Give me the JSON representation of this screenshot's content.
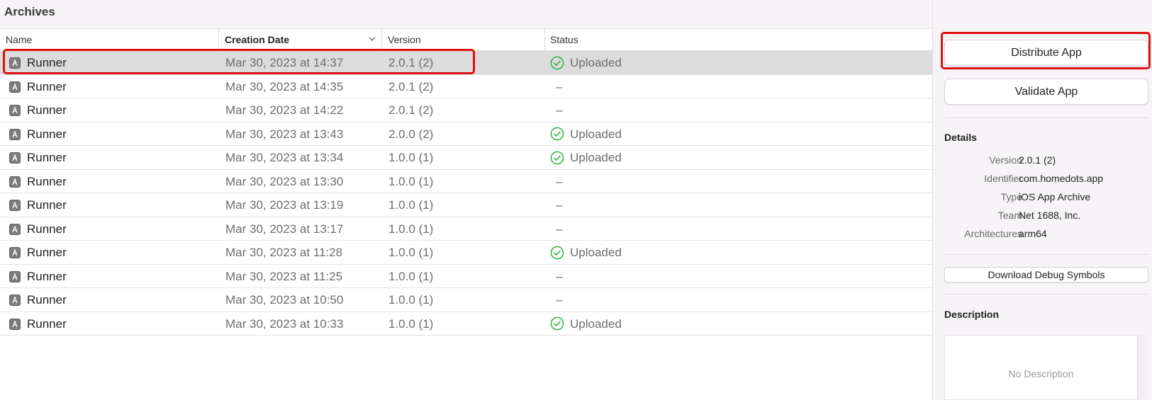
{
  "window": {
    "title": "Archives"
  },
  "columns": {
    "name": "Name",
    "creation_date": "Creation Date",
    "version": "Version",
    "status": "Status"
  },
  "archives": [
    {
      "name": "Runner",
      "date": "Mar 30, 2023 at 14:37",
      "version": "2.0.1 (2)",
      "status": "Uploaded",
      "uploaded": true,
      "selected": true
    },
    {
      "name": "Runner",
      "date": "Mar 30, 2023 at 14:35",
      "version": "2.0.1 (2)",
      "status": "–",
      "uploaded": false,
      "selected": false
    },
    {
      "name": "Runner",
      "date": "Mar 30, 2023 at 14:22",
      "version": "2.0.1 (2)",
      "status": "–",
      "uploaded": false,
      "selected": false
    },
    {
      "name": "Runner",
      "date": "Mar 30, 2023 at 13:43",
      "version": "2.0.0 (2)",
      "status": "Uploaded",
      "uploaded": true,
      "selected": false
    },
    {
      "name": "Runner",
      "date": "Mar 30, 2023 at 13:34",
      "version": "1.0.0 (1)",
      "status": "Uploaded",
      "uploaded": true,
      "selected": false
    },
    {
      "name": "Runner",
      "date": "Mar 30, 2023 at 13:30",
      "version": "1.0.0 (1)",
      "status": "–",
      "uploaded": false,
      "selected": false
    },
    {
      "name": "Runner",
      "date": "Mar 30, 2023 at 13:19",
      "version": "1.0.0 (1)",
      "status": "–",
      "uploaded": false,
      "selected": false
    },
    {
      "name": "Runner",
      "date": "Mar 30, 2023 at 13:17",
      "version": "1.0.0 (1)",
      "status": "–",
      "uploaded": false,
      "selected": false
    },
    {
      "name": "Runner",
      "date": "Mar 30, 2023 at 11:28",
      "version": "1.0.0 (1)",
      "status": "Uploaded",
      "uploaded": true,
      "selected": false
    },
    {
      "name": "Runner",
      "date": "Mar 30, 2023 at 11:25",
      "version": "1.0.0 (1)",
      "status": "–",
      "uploaded": false,
      "selected": false
    },
    {
      "name": "Runner",
      "date": "Mar 30, 2023 at 10:50",
      "version": "1.0.0 (1)",
      "status": "–",
      "uploaded": false,
      "selected": false
    },
    {
      "name": "Runner",
      "date": "Mar 30, 2023 at 10:33",
      "version": "1.0.0 (1)",
      "status": "Uploaded",
      "uploaded": true,
      "selected": false
    }
  ],
  "inspector": {
    "distribute_label": "Distribute App",
    "validate_label": "Validate App",
    "details_title": "Details",
    "details": {
      "version_key": "Version",
      "version_val": "2.0.1 (2)",
      "identifier_key": "Identifier",
      "identifier_val": "com.homedots.app",
      "type_key": "Type",
      "type_val": "iOS App Archive",
      "team_key": "Team",
      "team_val": "Net 1688, Inc.",
      "arch_key": "Architectures",
      "arch_val": "arm64"
    },
    "download_symbols_label": "Download Debug Symbols",
    "description_title": "Description",
    "description_placeholder": "No Description"
  },
  "colors": {
    "highlight": "#e01010",
    "uploaded_check": "#2fb24a",
    "selected_row": "#dcdcdc",
    "inspector_bg": "#f6f4f6"
  },
  "icons": {
    "app": "app-archive-icon",
    "uploaded": "checkmark-circle-icon",
    "sort": "chevron-down-icon"
  }
}
